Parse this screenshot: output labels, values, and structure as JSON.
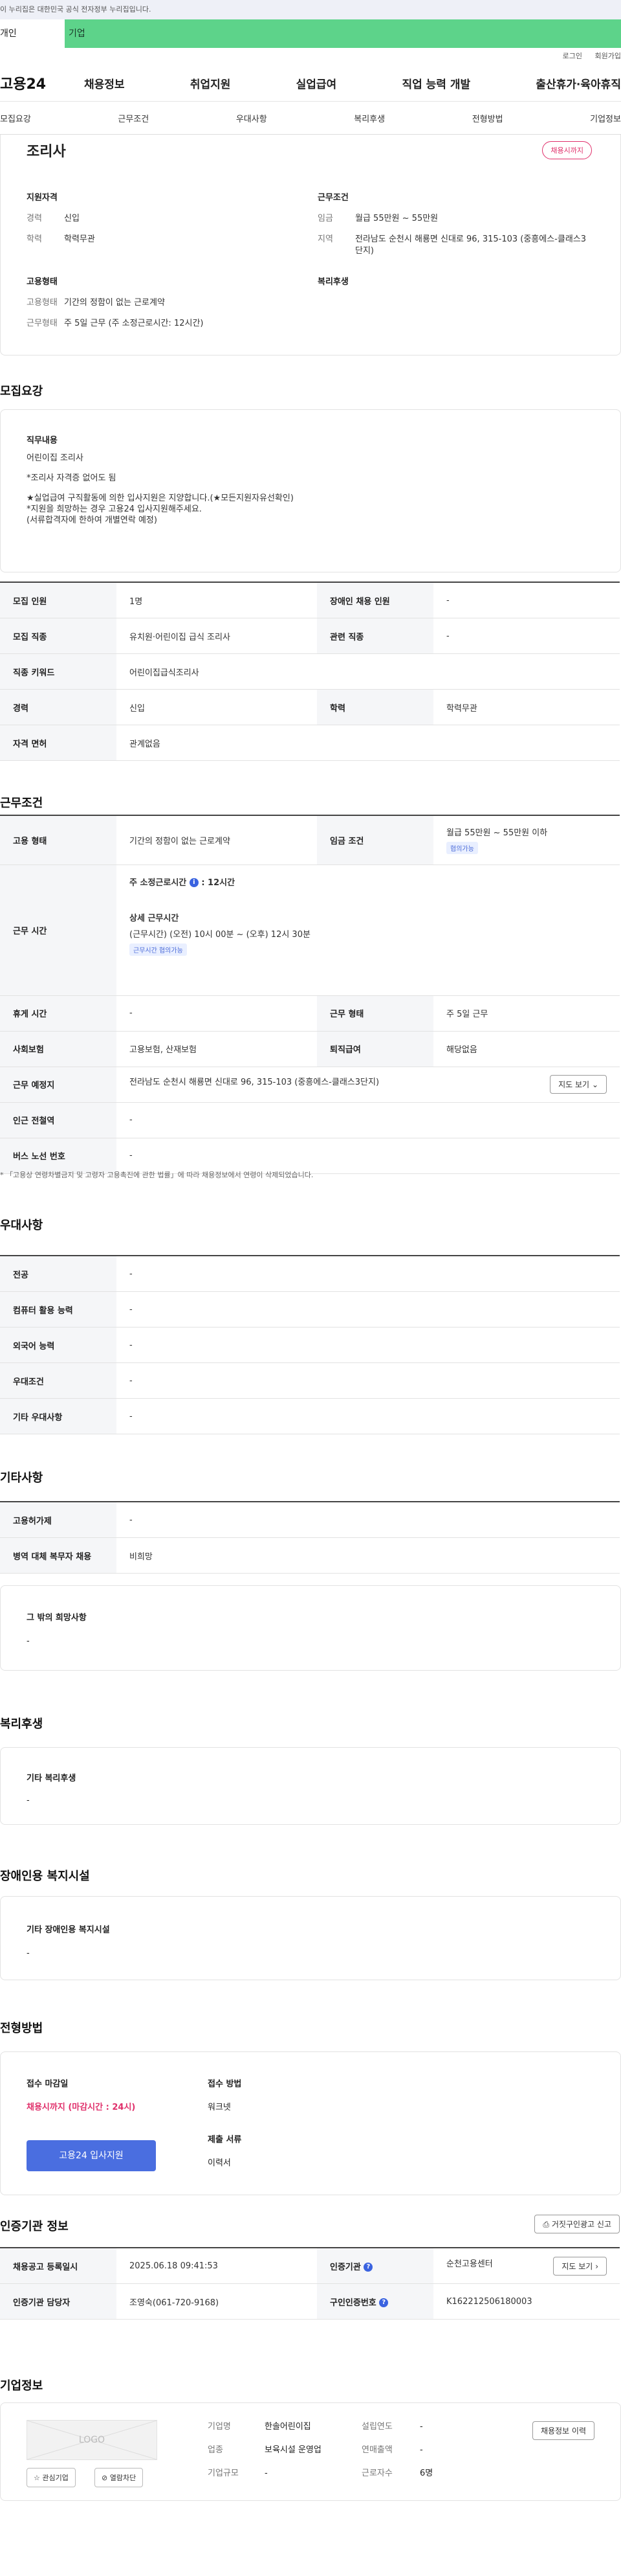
{
  "banner": {
    "text": "이 누리집은 대한민국 공식 전자정부 누리집입니다."
  },
  "member_type": {
    "personal": "개인",
    "company": "기업"
  },
  "top_links": [
    "로그인",
    "회원가입"
  ],
  "gnb": {
    "logo": "고용24",
    "menu": [
      "채용정보",
      "취업지원",
      "실업급여",
      "직업 능력 개발",
      "출산휴가·육아휴직"
    ]
  },
  "subnav": [
    "모집요강",
    "근무조건",
    "우대사항",
    "복리후생",
    "전형방법",
    "기업정보"
  ],
  "job": {
    "title": "조리사",
    "deadline_badge": "채용시까지",
    "qualification": {
      "heading": "지원자격",
      "rows": [
        {
          "k": "경력",
          "v": "신입"
        },
        {
          "k": "학력",
          "v": "학력무관"
        }
      ]
    },
    "employment": {
      "heading": "고용형태",
      "rows": [
        {
          "k": "고용형태",
          "v": "기간의 정함이 없는 근로계약"
        },
        {
          "k": "근무형태",
          "v": "주 5일 근무 (주 소정근로시간: 12시간)"
        }
      ]
    },
    "conditions": {
      "heading": "근무조건",
      "rows": [
        {
          "k": "임금",
          "v": "월급 55만원 ~ 55만원"
        },
        {
          "k": "지역",
          "v": "전라남도 순천시 해룡면 신대로 96, 315-103 (중흥에스-클래스3단지)"
        }
      ]
    },
    "welfare": {
      "heading": "복리후생"
    }
  },
  "recruit": {
    "title": "모집요강",
    "duty_heading": "직무내용",
    "duty_lines": [
      "어린이집 조리사",
      "",
      "*조리사 자격증 없어도 됨",
      "",
      "★실업급여 구직활동에 의한 입사지원은 지양합니다.(★모든지원자유선확인)",
      "*지원을 희망하는 경우 고용24 입사지원해주세요.",
      "(서류합격자에 한하여 개별연락 예정)"
    ],
    "table": {
      "headcount_k": "모집 인원",
      "headcount_v": "1명",
      "disabled_k": "장애인 채용 인원",
      "disabled_v": "-",
      "job_k": "모집 직종",
      "job_v": "유치원·어린이집 급식 조리사",
      "related_k": "관련 직종",
      "related_v": "-",
      "keyword_k": "직종 키워드",
      "keyword_v": "어린이집급식조리사",
      "career_k": "경력",
      "career_v": "신입",
      "edu_k": "학력",
      "edu_v": "학력무관",
      "license_k": "자격 면허",
      "license_v": "관계없음"
    }
  },
  "work": {
    "title": "근무조건",
    "emp_type_k": "고용 형태",
    "emp_type_v": "기간의 정함이 없는 근로계약",
    "wage_k": "임금 조건",
    "wage_v": "월급 55만원 ~ 55만원 이하",
    "wage_chip": "협의가능",
    "hours_k": "근무 시간",
    "hours_weekly_label": "주 소정근로시간",
    "hours_weekly_value": ": 12시간",
    "hours_detail_label": "상세 근무시간",
    "hours_detail_value": "(근무시간) (오전) 10시 00분 ~ (오후) 12시 30분",
    "hours_chip": "근무시간 협의가능",
    "break_k": "휴게 시간",
    "break_v": "-",
    "shift_k": "근무 형태",
    "shift_v": "주 5일 근무",
    "insurance_k": "사회보험",
    "insurance_v": "고용보험, 산재보험",
    "retire_k": "퇴직급여",
    "retire_v": "해당없음",
    "place_k": "근무 예정지",
    "place_v": "전라남도 순천시 해룡면 신대로 96, 315-103 (중흥에스-클래스3단지)",
    "map_btn": "지도 보기",
    "station_k": "인근 전철역",
    "station_v": "-",
    "bus_k": "버스 노선 번호",
    "bus_v": "-",
    "note": "* 「고용상 연령차별금지 및 고령자 고용촉진에 관한 법률」에 따라 채용정보에서 연령이 삭제되었습니다."
  },
  "pref": {
    "title": "우대사항",
    "rows": [
      {
        "k": "전공",
        "v": "-"
      },
      {
        "k": "컴퓨터 활용 능력",
        "v": "-"
      },
      {
        "k": "외국어 능력",
        "v": "-"
      },
      {
        "k": "우대조건",
        "v": "-"
      },
      {
        "k": "기타 우대사항",
        "v": "-"
      }
    ]
  },
  "etc": {
    "title": "기타사항",
    "rows": [
      {
        "k": "고용허가제",
        "v": "-"
      },
      {
        "k": "병역 대체 복무자 채용",
        "v": "비희망"
      }
    ],
    "other_heading": "그 밖의 희망사항",
    "other_value": "-"
  },
  "welfare": {
    "title": "복리후생",
    "heading": "기타 복리후생",
    "value": "-"
  },
  "disabled_facility": {
    "title": "장애인용 복지시설",
    "heading": "기타 장애인용 복지시설",
    "value": "-"
  },
  "selection": {
    "title": "전형방법",
    "deadline_heading": "접수 마감일",
    "deadline_value": "채용시까지 (마감시간 : 24시)",
    "apply_btn": "고용24 입사지원",
    "method_heading": "접수 방법",
    "method_value": "워크넷",
    "docs_heading": "제출 서류",
    "docs_value": "이력서"
  },
  "cert": {
    "title": "인증기관 정보",
    "report_btn": "거짓구인광고 신고",
    "reg_k": "채용공고 등록일시",
    "reg_v": "2025.06.18 09:41:53",
    "org_k": "인증기관",
    "org_v": "순천고용센터",
    "map_btn": "지도 보기",
    "manager_k": "인증기관 담당자",
    "manager_v": "조영숙(061-720-9168)",
    "num_k": "구인인증번호",
    "num_v": "K162212506180003"
  },
  "company": {
    "title": "기업정보",
    "logo_text": "LOGO",
    "interest_btn": "관심기업",
    "block_btn": "열람차단",
    "history_btn": "채용정보 이력",
    "rows": [
      {
        "k": "기업명",
        "v": "한솔어린이집",
        "k2": "설립연도",
        "v2": "-"
      },
      {
        "k": "업종",
        "v": "보육시설 운영업",
        "k2": "연매출액",
        "v2": "-"
      },
      {
        "k": "기업규모",
        "v": "-",
        "k2": "근로자수",
        "v2": "6명"
      }
    ]
  }
}
